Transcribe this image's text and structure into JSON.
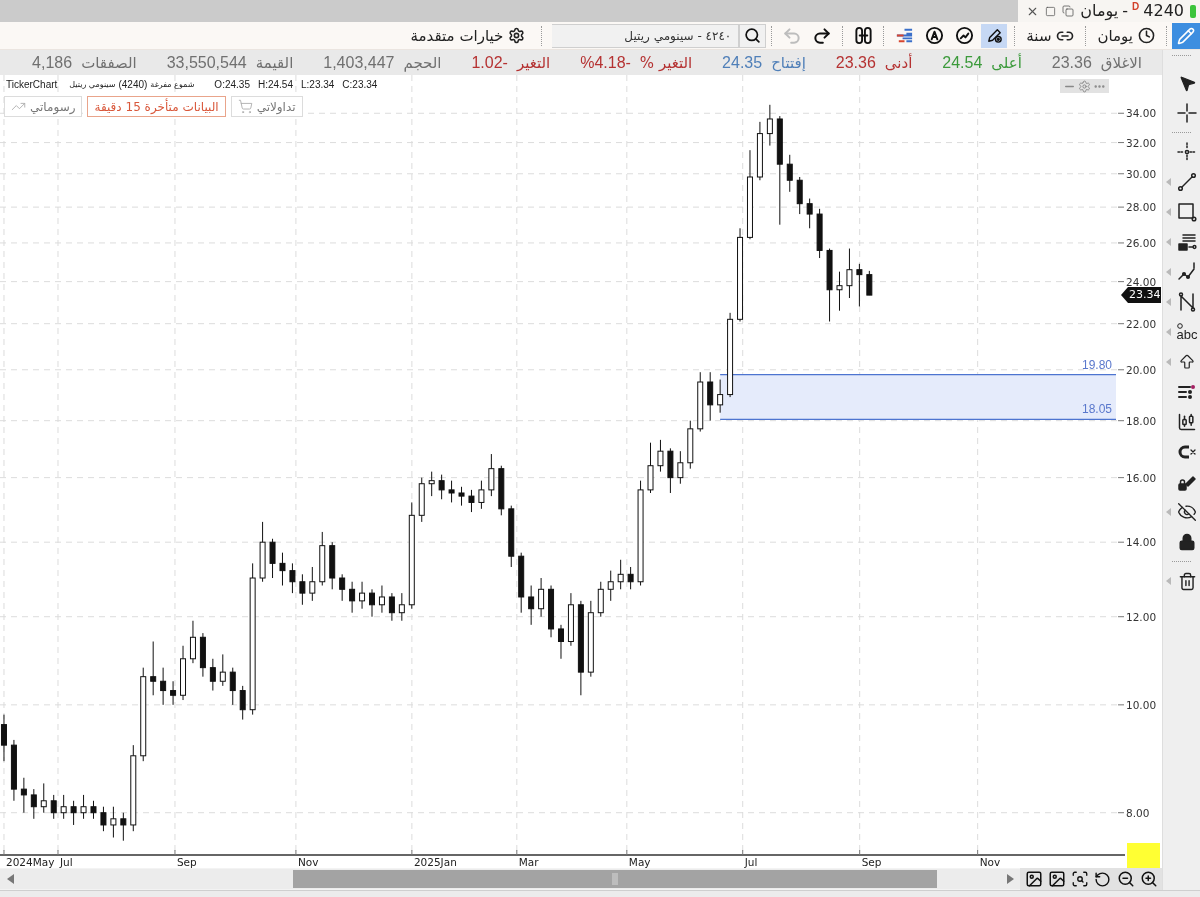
{
  "window": {
    "symbol": "4240",
    "badge": "D",
    "separator": "-",
    "period": "يومان"
  },
  "toolbar": {
    "draw_mode": {
      "selected": true
    },
    "interval": {
      "label": "يومان"
    },
    "range": {
      "label": "سنة"
    },
    "tools": [
      {
        "selected": true
      },
      {
        "selected": false
      },
      {
        "selected": false
      },
      {
        "selected": false
      }
    ],
    "history": [
      {
        "kind": "redo",
        "disabled": false
      },
      {
        "kind": "undo",
        "disabled": true
      }
    ],
    "search": {
      "value": "٤٢٤٠ - سينومي ريتيل"
    },
    "advanced": {
      "label": "خيارات متقدمة"
    }
  },
  "quote": [
    {
      "label": "الاغلاق",
      "value": "23.36",
      "color": "#707070"
    },
    {
      "label": "أعلى",
      "value": "24.54",
      "color": "#3b9a3b"
    },
    {
      "label": "أدنى",
      "value": "23.36",
      "color": "#b53232"
    },
    {
      "label": "إفتتاح",
      "value": "24.35",
      "color": "#4f7fb8"
    },
    {
      "label": "التغير %",
      "value": "%4.18-",
      "color": "#b53232"
    },
    {
      "label": "التغير",
      "value": "1.02-",
      "color": "#b53232"
    },
    {
      "label": "الحجم",
      "value": "1,403,447",
      "color": "#707070"
    },
    {
      "label": "القيمة",
      "value": "33,550,544",
      "color": "#707070"
    },
    {
      "label": "الصفقات",
      "value": "4,186",
      "color": "#707070"
    }
  ],
  "chart": {
    "legend": {
      "ohlc": [
        "C:23.34",
        "L:23.34",
        "H:24.54",
        "O:24.35"
      ],
      "chart_type": "شموع مفرغة",
      "code": "(4240)",
      "instrument": "سينومي ريتيل",
      "source": "TickerChart"
    },
    "buttons": [
      {
        "kind": "trades",
        "label": "تداولاتي"
      },
      {
        "kind": "notice",
        "label": "البيانات متأخرة 15 دقيقة"
      },
      {
        "kind": "drawings",
        "label": "رسوماتي"
      }
    ],
    "price_axis": [
      "34.00",
      "32.00",
      "30.00",
      "28.00",
      "26.00",
      "24.00",
      "22.00",
      "20.00",
      "18.00",
      "16.00",
      "14.00",
      "12.00",
      "10.00",
      "8.00"
    ],
    "last_price": "23.34",
    "zone": {
      "top_label": "19.80",
      "bottom_label": "18.05"
    },
    "time_axis": [
      "Nov",
      "Sep",
      "Jul",
      "May",
      "Mar",
      "2025Jan",
      "Nov",
      "Sep",
      "Jul",
      "2024May"
    ]
  },
  "side_toolbar": [
    {
      "has_menu": false
    },
    {
      "has_menu": false
    },
    {
      "has_menu": false
    },
    {
      "has_menu": true
    },
    {
      "has_menu": true
    },
    {
      "has_menu": true
    },
    {
      "has_menu": true
    },
    {
      "has_menu": true
    },
    {
      "has_menu": true,
      "label": "abc"
    },
    {
      "has_menu": true
    },
    {
      "has_menu": false
    },
    {
      "has_menu": false
    },
    {
      "has_menu": false
    },
    {
      "has_menu": false
    },
    {
      "has_menu": true
    },
    {
      "has_menu": false
    },
    {
      "has_menu": true
    }
  ]
}
